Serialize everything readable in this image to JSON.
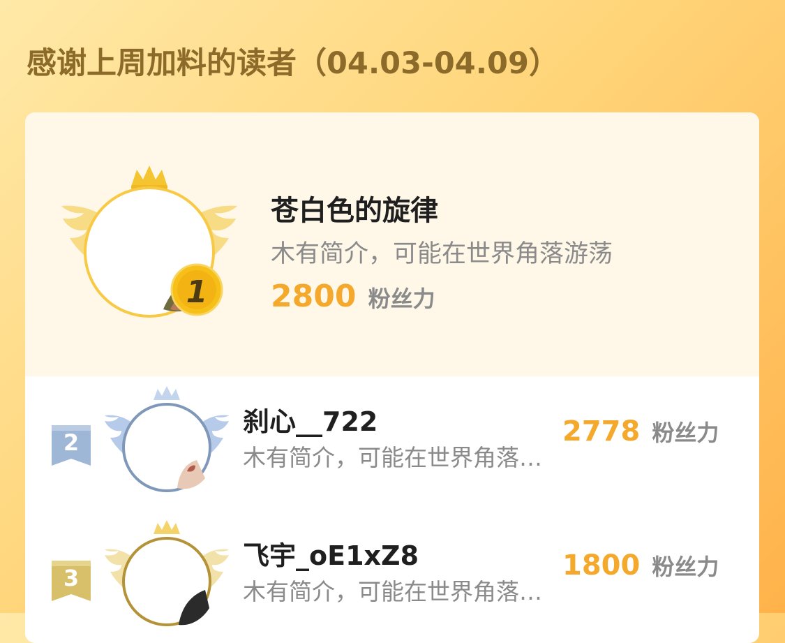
{
  "header": {
    "title": "感谢上周加料的读者（04.03-04.09）"
  },
  "leaderboard": {
    "unit_label": "粉丝力",
    "colors": {
      "score": "#f4a92c",
      "gold": "#f5c531",
      "silver": "#8da7c8",
      "bronze": "#b89a42"
    },
    "entries": [
      {
        "rank": "1",
        "name": "苍白色的旋律",
        "bio": "木有简介，可能在世界角落游荡",
        "score": "2800"
      },
      {
        "rank": "2",
        "name": "刹心__722",
        "bio": "木有简介，可能在世界角落游荡",
        "score": "2778"
      },
      {
        "rank": "3",
        "name": "飞宇_oE1xZ8",
        "bio": "木有简介，可能在世界角落游荡",
        "score": "1800"
      }
    ]
  }
}
